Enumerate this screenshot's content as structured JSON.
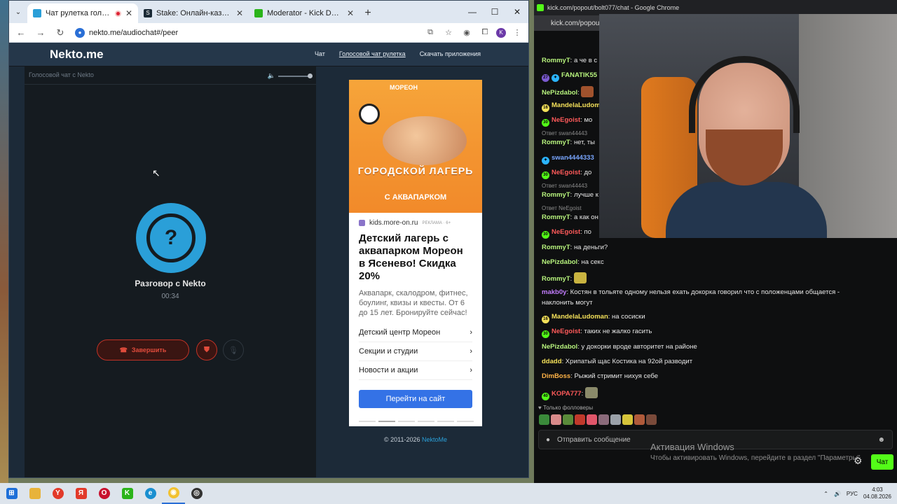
{
  "browser_left": {
    "tabs": [
      {
        "title": "Чат рулетка голосовая — N",
        "active": true
      },
      {
        "title": "Stake: Онлайн-казино и ставки",
        "active": false
      },
      {
        "title": "Moderator - Kick Dashboard",
        "active": false
      }
    ],
    "url": "nekto.me/audiochat#/peer"
  },
  "site": {
    "logo": "Nekto.me",
    "nav": [
      "Чат",
      "Голосовой чат рулетка",
      "Скачать приложения"
    ]
  },
  "voice": {
    "panel_title": "Голосовой чат с Nekto",
    "peer_name": "Разговор с Nekto",
    "timer": "00:34",
    "end_label": "Завершить",
    "icon_glyph": "?"
  },
  "ad": {
    "brand": "МОРЕОН",
    "banner_title": "ГОРОДСКОЙ ЛАГЕРЬ",
    "banner_sub": "С АКВАПАРКОМ",
    "source": "kids.more-on.ru",
    "tag": "РЕКЛАМА · 6+",
    "headline": "Детский лагерь с аквапарком Мореон в Ясеневo! Скидка 20%",
    "body": "Аквапарк, скалодром, фитнес, боулинг, квизы и квесты. От 6 до 15 лет. Бронируйте сейчас!",
    "links": [
      "Детский центр Мореон",
      "Секции и студии",
      "Новости и акции"
    ],
    "cta": "Перейти на сайт"
  },
  "footer": {
    "copyright": "© 2011-2026",
    "brand_link": "NektoMe"
  },
  "browser_right": {
    "title": "kick.com/popout/bolt077/chat - Google Chrome",
    "url": "kick.com/popou"
  },
  "chat": {
    "messages": [
      {
        "user": "RommyT",
        "text": "а че в с",
        "color": "#b7f37d"
      },
      {
        "user": "FANATIK55",
        "text": "",
        "color": "#b7f37d"
      },
      {
        "user": "NePizdabol",
        "text": "",
        "color": "#b7f37d"
      },
      {
        "user": "MandelaLudom",
        "text": "",
        "color": "#f5e15a"
      },
      {
        "user": "NeEgoist",
        "text": "мо",
        "color": "#ff5a5a"
      },
      {
        "user": "RommyT",
        "text": "нет, ты",
        "color": "#b7f37d"
      },
      {
        "user": "swan4444333",
        "text": "",
        "color": "#79a6ff"
      },
      {
        "user": "NeEgoist",
        "text": "до",
        "color": "#ff5a5a"
      },
      {
        "user": "RommyT",
        "text": "лучше к",
        "color": "#b7f37d"
      },
      {
        "user": "RommyT",
        "text": "а как он",
        "color": "#b7f37d"
      },
      {
        "user": "NeEgoist",
        "text": "по",
        "color": "#ff5a5a"
      },
      {
        "user": "RommyT",
        "text": "на деньги?",
        "color": "#b7f37d"
      },
      {
        "user": "NePizdabol",
        "text": "на секс",
        "color": "#b7f37d"
      },
      {
        "user": "RommyT",
        "text": "",
        "color": "#b7f37d"
      },
      {
        "user": "makb0y",
        "text": "Костян в тольяте одному нельзя ехать докорка говорил что с положенцами общается -",
        "color": "#c37dff"
      },
      {
        "user": "",
        "text": "наклонить могут",
        "color": "#ffffff"
      },
      {
        "user": "MandelaLudoman",
        "text": "на сосиски",
        "color": "#f5e15a"
      },
      {
        "user": "NeEgoist",
        "text": "таких не жалко гасить",
        "color": "#ff5a5a"
      },
      {
        "user": "NePizdabol",
        "text": "у докорки вроде авторитет на районе",
        "color": "#b7f37d"
      },
      {
        "user": "ddadd",
        "text": "Хрипатый щас Костика на 92ой разводит",
        "color": "#f5e15a"
      },
      {
        "user": "DimBoss",
        "text": "Рыжий стримит нихуя себе",
        "color": "#ffb347"
      },
      {
        "user": "KOPA777",
        "text": "",
        "color": "#ff5a5a"
      }
    ],
    "replies": [
      "Ответ swan44443",
      "Ответ swan44443",
      "Ответ NeEgoist"
    ],
    "followers_only": "Только фолловеры",
    "input_placeholder": "Отправить сообщение",
    "chat_button": "Чат"
  },
  "windows": {
    "activation_title": "Активация Windows",
    "activation_text": "Чтобы активировать Windows, перейдите в раздел \"Параметры\".",
    "lang": "РУС",
    "time": "4:03",
    "date": "04.08.2026"
  }
}
